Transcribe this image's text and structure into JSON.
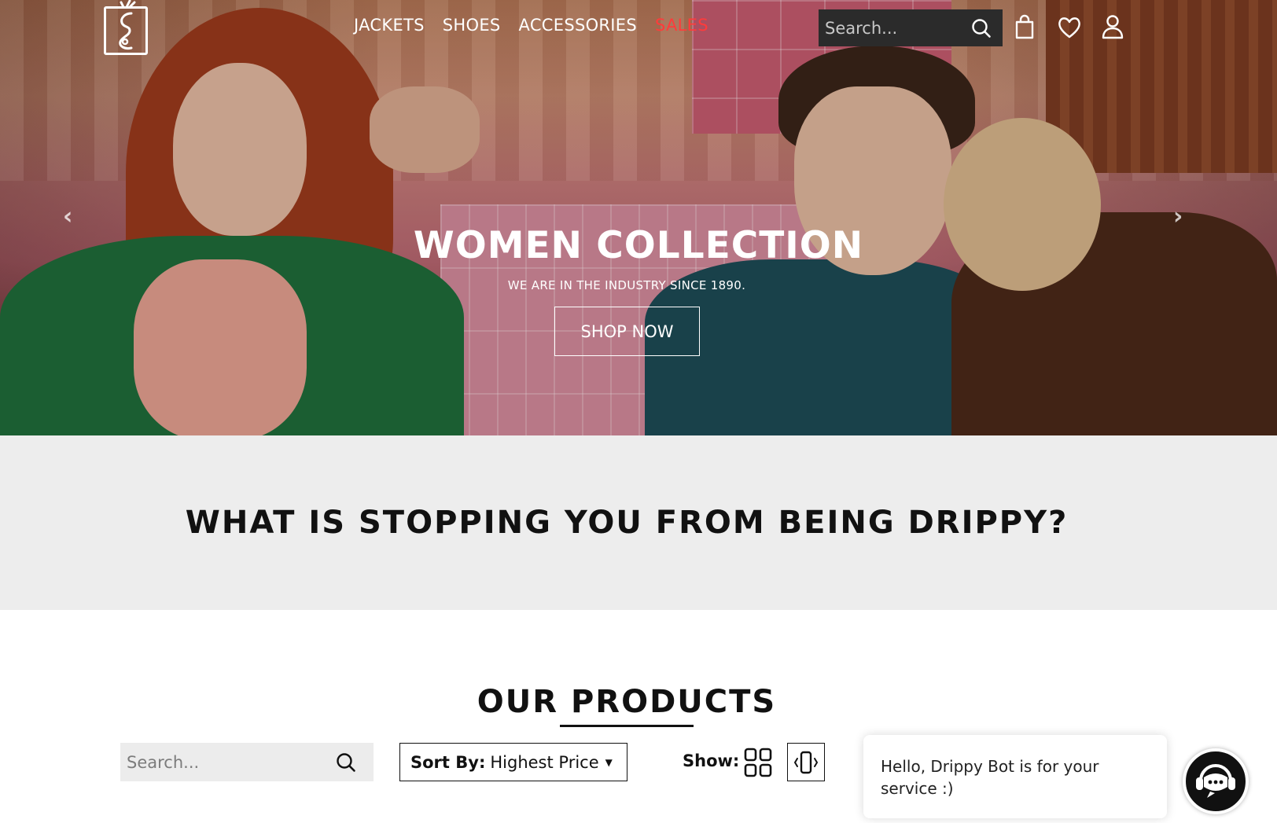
{
  "nav": {
    "items": [
      {
        "label": "JACKETS"
      },
      {
        "label": "SHOES"
      },
      {
        "label": "ACCESSORIES"
      },
      {
        "label": "SALES"
      }
    ],
    "search_placeholder": "Search...",
    "icons": [
      "search-icon",
      "shopping-bag-icon",
      "heart-icon",
      "user-icon"
    ]
  },
  "hero": {
    "title": "WOMEN COLLECTION",
    "subtitle": "WE ARE IN THE INDUSTRY SINCE 1890.",
    "cta": "SHOP NOW",
    "arrows": {
      "prev": "‹",
      "next": "›"
    }
  },
  "banner": {
    "headline": "WHAT IS STOPPING YOU FROM BEING DRIPPY?"
  },
  "products": {
    "title": "OUR PRODUCTS",
    "search_placeholder": "Search...",
    "sort_label": "Sort By:",
    "sort_value": "Highest Price",
    "show_label": "Show:"
  },
  "chat": {
    "message": "Hello, Drippy Bot is for your service :)"
  },
  "colors": {
    "accent_sale": "#ff3b3b",
    "dark": "#111111",
    "banner_bg": "#ededed",
    "search_bg": "#2b2b2b"
  }
}
